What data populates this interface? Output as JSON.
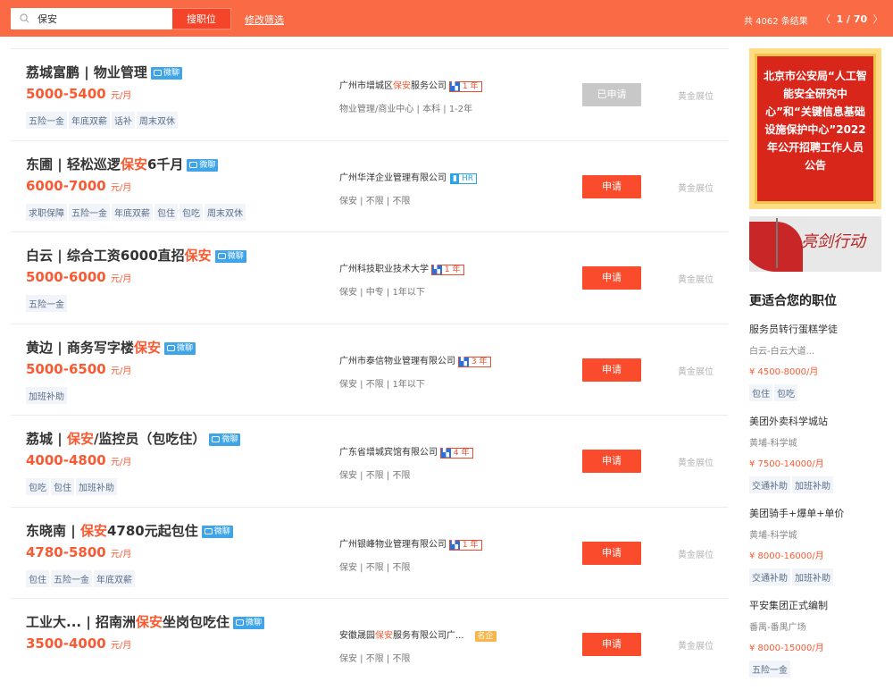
{
  "colors": {
    "brand": "#fa6b45",
    "accent": "#fa5a32",
    "apply": "#fa4c2c",
    "applied": "#c8c8c8"
  },
  "header": {
    "search_value": "保安",
    "search_icon": "search-icon",
    "search_button": "搜职位",
    "filter_link": "修改筛选",
    "result_count": "共 4062 条结果",
    "page_prev": "〈",
    "page_indicator": "1 / 70",
    "page_next": "〉"
  },
  "jobs": [
    {
      "title_before": "荔城富鹏 | 物业管理",
      "title_hl": "",
      "title_after": "",
      "chat": "微聊",
      "salary": "5000-5400",
      "salary_unit": "元/月",
      "tags": [
        "五险一金",
        "年底双薪",
        "话补",
        "周末双休"
      ],
      "company_before": "广州市增城区",
      "company_hl": "保安",
      "company_after": "服务公司",
      "badge_type": "year",
      "badge": "1 年",
      "meta": "物业管理/商业中心 | 本科 | 1-2年",
      "apply": "已申请",
      "applied": true,
      "premium": "黄金展位"
    },
    {
      "title_before": "东圃 | 轻松巡逻",
      "title_hl": "保安",
      "title_after": "6千月",
      "chat": "微聊",
      "salary": "6000-7000",
      "salary_unit": "元/月",
      "tags": [
        "求职保障",
        "五险一金",
        "年底双薪",
        "包住",
        "包吃",
        "周末双休"
      ],
      "company_before": "广州华洋企业管理有限公司",
      "company_hl": "",
      "company_after": "",
      "badge_type": "hr",
      "badge": "HR",
      "meta": "保安 | 不限 | 不限",
      "apply": "申请",
      "applied": false,
      "premium": "黄金展位"
    },
    {
      "title_before": "白云 | 综合工资6000直招",
      "title_hl": "保安",
      "title_after": "",
      "chat": "微聊",
      "salary": "5000-6000",
      "salary_unit": "元/月",
      "tags": [
        "五险一金"
      ],
      "company_before": "广州科技职业技术大学",
      "company_hl": "",
      "company_after": "",
      "badge_type": "year",
      "badge": "1 年",
      "meta": "保安 | 中专 | 1年以下",
      "apply": "申请",
      "applied": false,
      "premium": "黄金展位"
    },
    {
      "title_before": "黄边 | 商务写字楼",
      "title_hl": "保安",
      "title_after": "",
      "chat": "微聊",
      "salary": "5000-6500",
      "salary_unit": "元/月",
      "tags": [
        "加班补助"
      ],
      "company_before": "广州市泰信物业管理有限公司",
      "company_hl": "",
      "company_after": "",
      "badge_type": "year",
      "badge": "3 年",
      "meta": "保安 | 不限 | 1年以下",
      "apply": "申请",
      "applied": false,
      "premium": "黄金展位"
    },
    {
      "title_before": "荔城 | ",
      "title_hl": "保安",
      "title_after": "/监控员（包吃住）",
      "chat": "微聊",
      "salary": "4000-4800",
      "salary_unit": "元/月",
      "tags": [
        "包吃",
        "包住",
        "加班补助"
      ],
      "company_before": "广东省增城宾馆有限公司",
      "company_hl": "",
      "company_after": "",
      "badge_type": "year",
      "badge": "4 年",
      "meta": "保安 | 不限 | 不限",
      "apply": "申请",
      "applied": false,
      "premium": "黄金展位"
    },
    {
      "title_before": "东晓南 | ",
      "title_hl": "保安",
      "title_after": "4780元起包住",
      "chat": "微聊",
      "salary": "4780-5800",
      "salary_unit": "元/月",
      "tags": [
        "包住",
        "五险一金",
        "年底双薪"
      ],
      "company_before": "广州银峰物业管理有限公司",
      "company_hl": "",
      "company_after": "",
      "badge_type": "year",
      "badge": "1 年",
      "meta": "保安 | 不限 | 不限",
      "apply": "申请",
      "applied": false,
      "premium": "黄金展位"
    },
    {
      "title_before": "工业大... | 招南洲",
      "title_hl": "保安",
      "title_after": "坐岗包吃住",
      "chat": "微聊",
      "salary": "3500-4000",
      "salary_unit": "元/月",
      "tags": [],
      "company_before": "安徽晟园",
      "company_hl": "保安",
      "company_after": "服务有限公司广...",
      "badge_type": "mq",
      "badge": "名企",
      "meta": "保安 | 不限 | 不限",
      "apply": "申请",
      "applied": false,
      "premium": "黄金展位"
    }
  ],
  "sidebar": {
    "banner_text": "北京市公安局“人工智能安全研究中心”和“关键信息基础设施保护中心”2022年公开招聘工作人员公告",
    "banner2_text": "亮剑行动",
    "heading": "更适合您的职位",
    "recs": [
      {
        "title": "服务员转行蛋糕学徒",
        "loc": "白云-白云大道...",
        "salary": "¥ 4500-8000/月",
        "tags": [
          "包住",
          "包吃"
        ]
      },
      {
        "title": "美团外卖科学城站",
        "loc": "黄埔-科学城",
        "salary": "¥ 7500-14000/月",
        "tags": [
          "交通补助",
          "加班补助"
        ]
      },
      {
        "title": "美团骑手+爆单+单价",
        "loc": "黄埔-科学城",
        "salary": "¥ 8000-16000/月",
        "tags": [
          "交通补助",
          "加班补助"
        ]
      },
      {
        "title": "平安集团正式编制",
        "loc": "番禺-番禺广场",
        "salary": "¥ 8000-15000/月",
        "tags": [
          "五险一金"
        ]
      }
    ]
  }
}
